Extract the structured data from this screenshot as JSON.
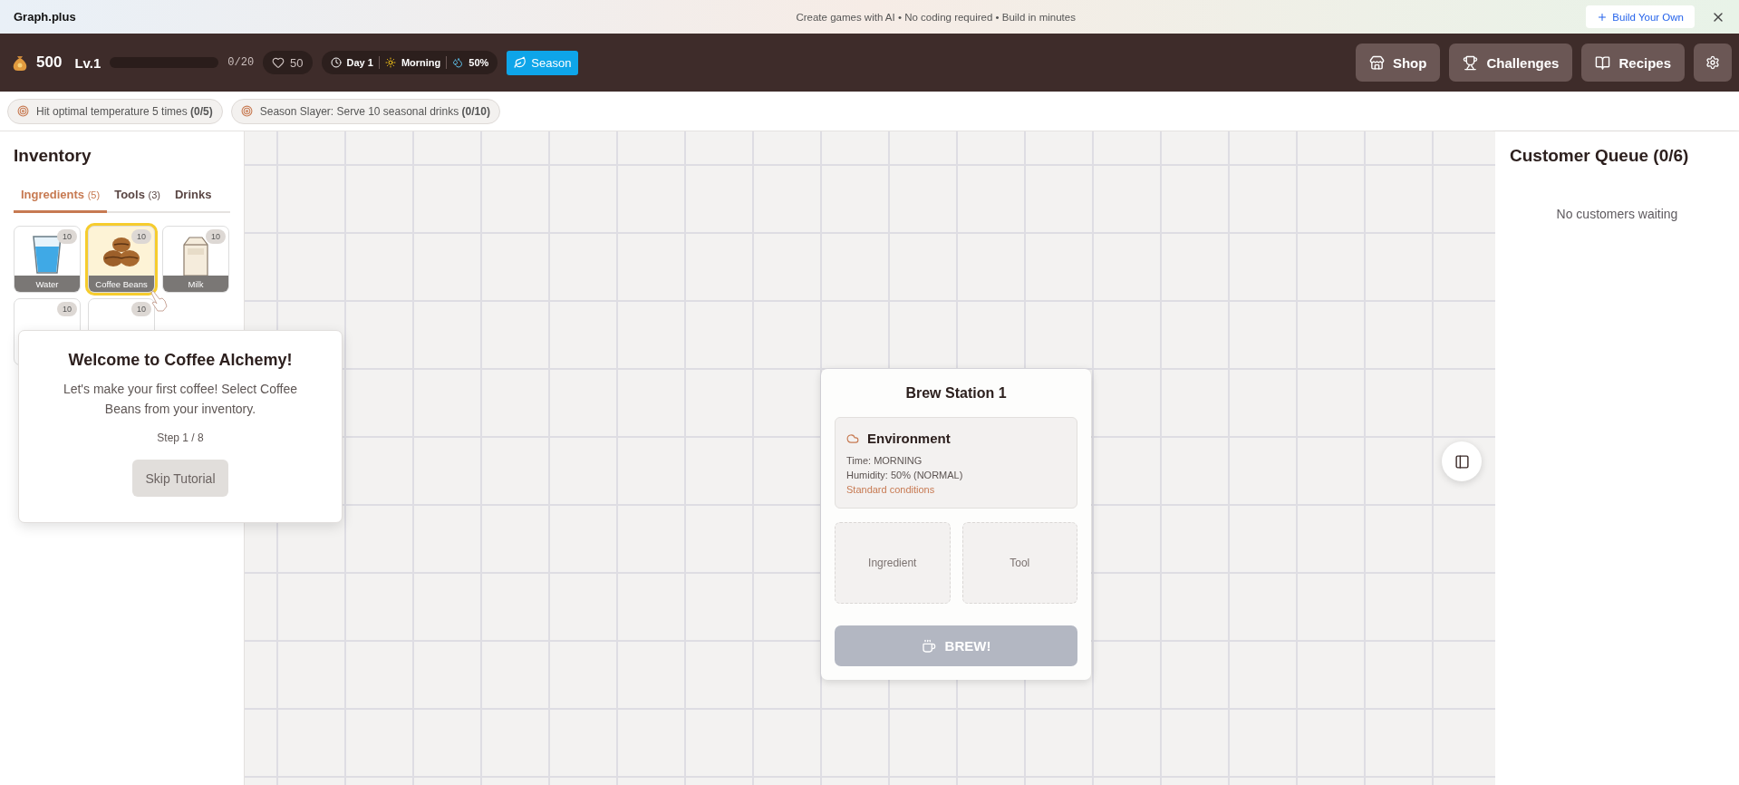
{
  "banner": {
    "brand": "Graph.plus",
    "tagline": "Create games with AI • No coding required • Build in minutes",
    "cta": "Build Your Own"
  },
  "header": {
    "coins": "500",
    "level_label": "Lv.1",
    "xp": {
      "level": 0,
      "reading": "0/20"
    },
    "hearts": "50",
    "day": "Day 1",
    "time": "Morning",
    "humidity": "50%",
    "season_button": "Season",
    "buttons": [
      {
        "kind": "shop",
        "label": "Shop"
      },
      {
        "kind": "challenges",
        "label": "Challenges"
      },
      {
        "kind": "recipes",
        "label": "Recipes"
      },
      {
        "kind": "settings"
      }
    ]
  },
  "challenges": [
    {
      "text": "Hit optimal temperature 5 times **(0/5)**"
    },
    {
      "text": "Season Slayer: Serve 10 seasonal drinks **(0/10)**"
    }
  ],
  "inventory": {
    "title": "Inventory",
    "tabs": [
      {
        "label": "Ingredients",
        "count": "(5)",
        "selected": true
      },
      {
        "label": "Tools",
        "count": "(3)",
        "selected": false
      },
      {
        "label": "Drinks",
        "selected": false
      }
    ],
    "items": [
      {
        "kind": "water",
        "name": "Water",
        "count": "10",
        "selected": false
      },
      {
        "kind": "beans",
        "name": "Coffee Beans",
        "count": "10",
        "selected": true
      },
      {
        "kind": "milk",
        "name": "Milk",
        "count": "10",
        "selected": false
      },
      {
        "kind": "covered",
        "count": "10",
        "selected": false
      },
      {
        "kind": "covered",
        "count": "10",
        "selected": false
      }
    ]
  },
  "tutorial": {
    "title": "Welcome to Coffee Alchemy!",
    "body": "Let's make your first coffee! Select Coffee Beans from your inventory.",
    "step": "Step 1 / 8",
    "button": "Skip Tutorial"
  },
  "station": {
    "title": "Brew Station 1",
    "environment": {
      "title": "Environment",
      "lines": [
        "Time: MORNING",
        "Humidity: 50% (NORMAL)"
      ],
      "note": "Standard conditions"
    },
    "slots": [
      "Ingredient",
      "Tool"
    ],
    "brew_button": {
      "label": "BREW!",
      "disabled": true
    }
  },
  "queue": {
    "title": "Customer Queue (0/6)",
    "empty_text": "No customers waiting"
  }
}
